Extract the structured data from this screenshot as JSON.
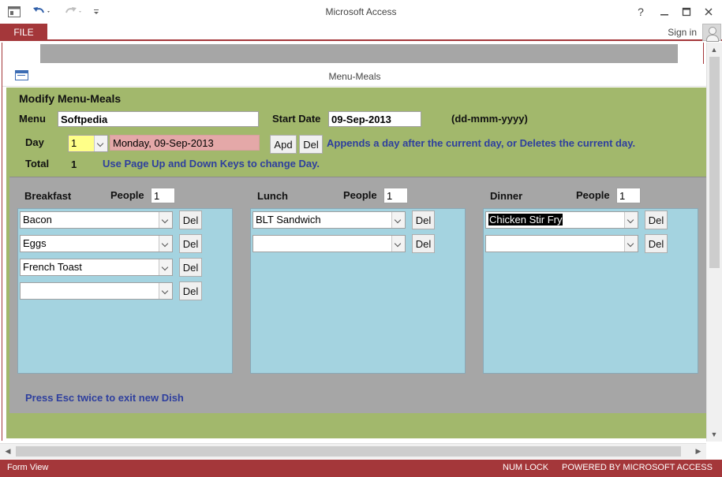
{
  "window": {
    "title": "Microsoft Access",
    "help": "?",
    "min": "–",
    "max": "☐",
    "close": "✕"
  },
  "ribbon": {
    "file_tab": "FILE",
    "signin": "Sign in"
  },
  "form": {
    "window_title": "Menu-Meals",
    "heading": "Modify Menu-Meals",
    "menu_label": "Menu",
    "menu_value": "Softpedia",
    "start_date_label": "Start Date",
    "start_date_value": "09-Sep-2013",
    "date_format_hint": "(dd-mmm-yyyy)",
    "day_label": "Day",
    "day_value": "1",
    "day_date": "Monday, 09-Sep-2013",
    "apd_button": "Apd",
    "del_button": "Del",
    "append_hint": "Appends a day after the current day, or Deletes the current day.",
    "total_label": "Total",
    "total_value": "1",
    "page_hint": "Use Page Up and Down Keys to change Day.",
    "esc_hint": "Press Esc twice to exit new Dish"
  },
  "meals": [
    {
      "name": "Breakfast",
      "people_label": "People",
      "people": "1",
      "dishes": [
        "Bacon",
        "Eggs",
        "French Toast",
        ""
      ]
    },
    {
      "name": "Lunch",
      "people_label": "People",
      "people": "1",
      "dishes": [
        "BLT Sandwich",
        ""
      ]
    },
    {
      "name": "Dinner",
      "people_label": "People",
      "people": "1",
      "dishes": [
        "Chicken Stir Fry",
        ""
      ]
    }
  ],
  "dish_del_label": "Del",
  "status": {
    "left": "Form View",
    "numlock": "NUM LOCK",
    "powered": "POWERED BY MICROSOFT ACCESS"
  },
  "colors": {
    "accent": "#a4373a",
    "form_bg": "#a2b86c",
    "subform_bg": "#a6a6a6",
    "meal_box": "#a4d3e0",
    "note_text": "#2e3f9e",
    "day_date_bg": "#e4a8a8",
    "day_combo_bg": "#ffff88"
  }
}
